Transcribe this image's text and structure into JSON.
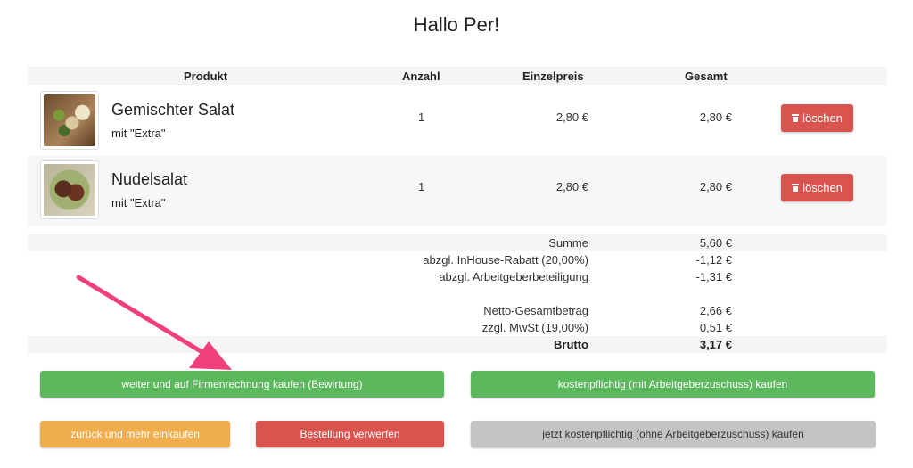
{
  "page": {
    "title": "Hallo Per!"
  },
  "table": {
    "headers": {
      "product": "Produkt",
      "quantity": "Anzahl",
      "unit_price": "Einzelpreis",
      "total": "Gesamt"
    }
  },
  "items": [
    {
      "name": "Gemischter Salat",
      "extra": "mit \"Extra\"",
      "quantity": "1",
      "unit_price": "2,80 €",
      "total": "2,80 €",
      "delete_label": "löschen",
      "image": "salad-photo"
    },
    {
      "name": "Nudelsalat",
      "extra": "mit \"Extra\"",
      "quantity": "1",
      "unit_price": "2,80 €",
      "total": "2,80 €",
      "delete_label": "löschen",
      "image": "pasta-salad-photo"
    }
  ],
  "summary": {
    "sum_label": "Summe",
    "sum_value": "5,60 €",
    "discount_label": "abzgl. InHouse-Rabatt (20,00%)",
    "discount_value": "-1,12 €",
    "employer_label": "abzgl. Arbeitgeberbeteiligung",
    "employer_value": "-1,31 €",
    "net_label": "Netto-Gesamtbetrag",
    "net_value": "2,66 €",
    "vat_label": "zzgl. MwSt (19,00%)",
    "vat_value": "0,51 €",
    "gross_label": "Brutto",
    "gross_value": "3,17 €"
  },
  "buttons": {
    "company_invoice": "weiter und auf Firmenrechnung kaufen (Bewirtung)",
    "paid_with_subsidy": "kostenpflichtig (mit Arbeitgeberzuschuss) kaufen",
    "back_shopping": "zurück und mehr einkaufen",
    "discard_order": "Bestellung verwerfen",
    "paid_without_subsidy": "jetzt kostenpflichtig (ohne Arbeitgeberzuschuss) kaufen"
  },
  "colors": {
    "green": "#5cb85c",
    "red": "#d9534f",
    "orange": "#f0ad4e",
    "grey": "#c4c4c4",
    "arrow": "#f0407a"
  },
  "icons": {
    "delete": "trash-icon",
    "annotation": "pink-arrow-icon"
  }
}
